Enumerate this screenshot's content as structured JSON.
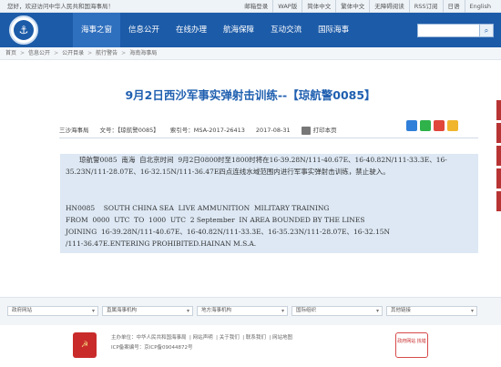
{
  "topbar": {
    "welcome": "您好，欢迎访问中华人民共和国海事局！",
    "links": [
      "邮箱登录",
      "WAP版",
      "简体中文",
      "繁体中文",
      "无障碍阅读",
      "RSS订阅",
      "日语",
      "English"
    ]
  },
  "nav": {
    "items": [
      "海事之窗",
      "信息公开",
      "在线办理",
      "航海保障",
      "互动交流",
      "国际海事"
    ]
  },
  "search": {
    "placeholder": ""
  },
  "breadcrumb": [
    "首页",
    "信息公开",
    "公开目录",
    "航行警告",
    "海南海事局"
  ],
  "article": {
    "title": "9月2日西沙军事实弹射击训练--【琼航警0085】",
    "source": "三沙海事局",
    "doc_no_label": "文号：",
    "doc_no": "【琼航警0085】",
    "index_label": "索引号：",
    "index_no": "MSA-2017-26413",
    "date": "2017-08-31",
    "print_label": "打印本页",
    "body_cn": "琼航警0085  南海  自北京时间  9月2日0800时至1800时将在16-39.28N/111-40.67E、16-40.82N/111-33.3E、16-35.23N/111-28.07E、16-32.15N/111-36.47E四点连线水域范围内进行军事实弹射击训练，禁止驶入。",
    "body_en": "HN0085    SOUTH CHINA SEA  LIVE AMMUNITION  MILITARY TRAINING\nFROM  0000  UTC  TO  1000  UTC  2 September  IN AREA BOUNDED BY THE LINES\nJOINING  16-39.28N/111-40.67E、16-40.82N/111-33.3E、16-35.23N/111-28.07E、16-32.15N\n/111-36.47E.ENTERING PROHIBITED.HAINAN M.S.A."
  },
  "footer": {
    "selects": [
      "政府网站",
      "直属海事机构",
      "地方海事机构",
      "国际组织",
      "其他链接"
    ],
    "sponsor": "主办单位：中华人民共和国海事局",
    "links": [
      "网站声明",
      "关于我们",
      "联系我们",
      "网站地图"
    ],
    "icp": "ICP备案编号：京ICP备09044872号",
    "badge": "政府网站 找错"
  },
  "colors": {
    "brand_blue": "#1c5ba8",
    "content_bg": "#dde8f4",
    "title_blue": "#1f5fb0"
  }
}
